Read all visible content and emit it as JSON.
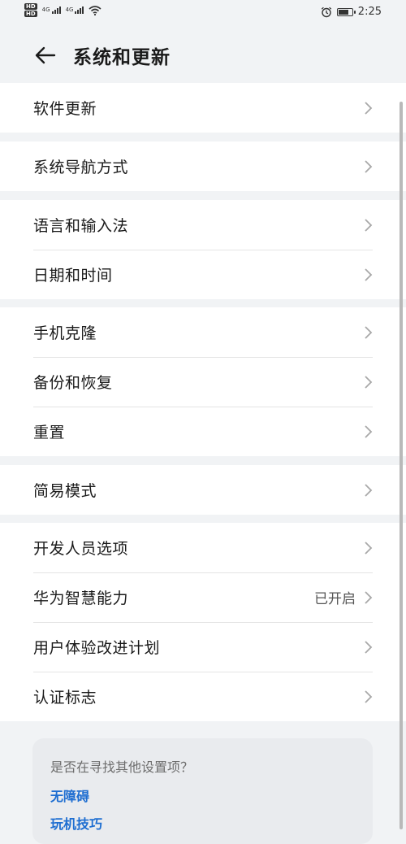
{
  "status_bar": {
    "time": "2:25",
    "hd_labels": [
      "HD",
      "HD"
    ],
    "network_labels": [
      "4G",
      "4G"
    ],
    "icons": [
      "hd-icon",
      "signal-icon",
      "wifi-icon",
      "alarm-icon",
      "battery-icon"
    ]
  },
  "header": {
    "title": "系统和更新",
    "back_icon": "arrow-left-icon"
  },
  "groups": [
    [
      {
        "label": "软件更新"
      }
    ],
    [
      {
        "label": "系统导航方式"
      }
    ],
    [
      {
        "label": "语言和输入法"
      },
      {
        "label": "日期和时间"
      }
    ],
    [
      {
        "label": "手机克隆"
      },
      {
        "label": "备份和恢复"
      },
      {
        "label": "重置"
      }
    ],
    [
      {
        "label": "简易模式"
      }
    ],
    [
      {
        "label": "开发人员选项"
      },
      {
        "label": "华为智慧能力",
        "value": "已开启"
      },
      {
        "label": "用户体验改进计划"
      },
      {
        "label": "认证标志"
      }
    ]
  ],
  "suggestion": {
    "question": "是否在寻找其他设置项？",
    "links": [
      "无障碍",
      "玩机技巧"
    ]
  },
  "colors": {
    "background": "#f1f3f5",
    "card": "#ffffff",
    "link": "#1e6ed1",
    "divider": "#e4e4e4"
  }
}
